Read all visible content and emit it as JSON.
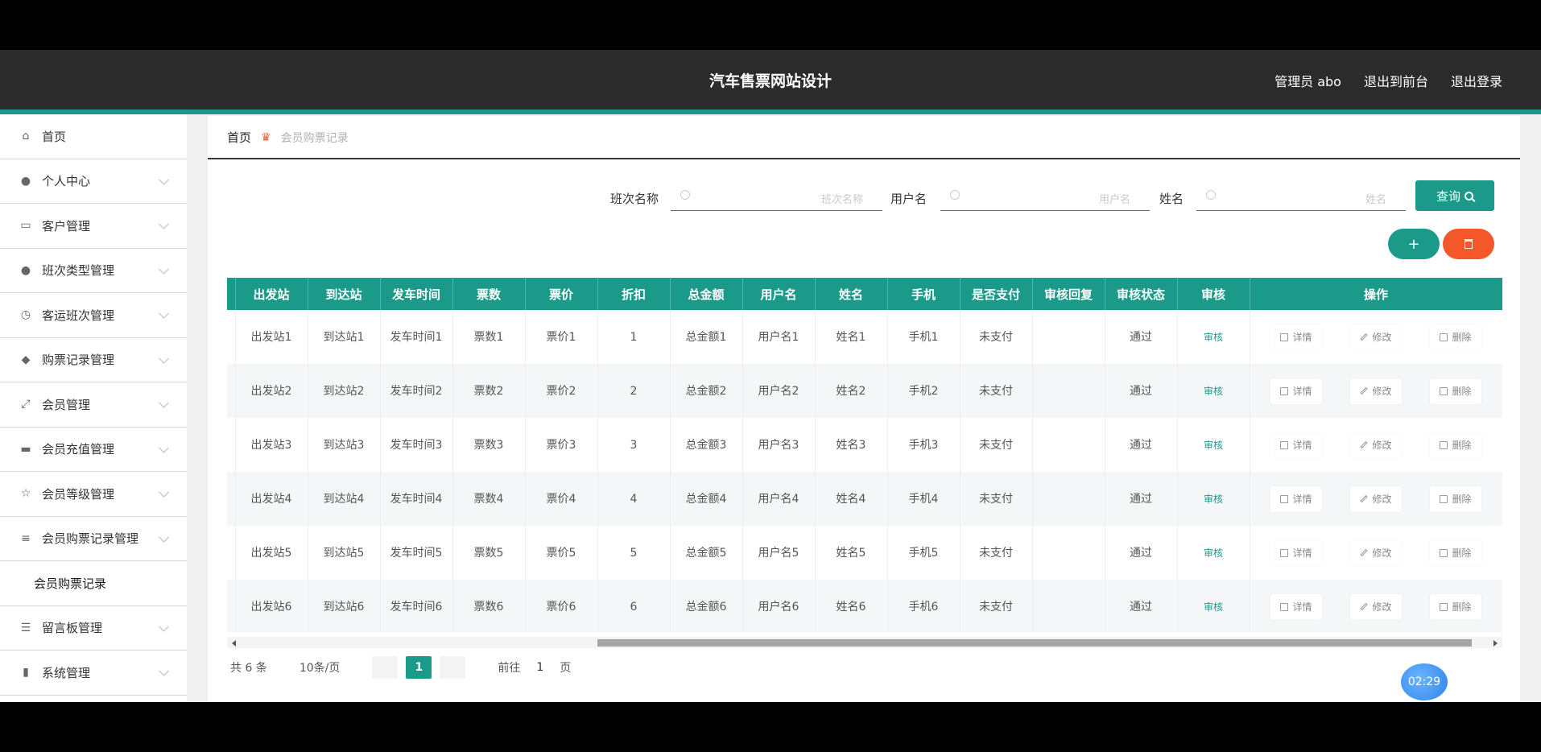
{
  "header": {
    "title": "汽车售票网站设计",
    "links": [
      "管理员 abo",
      "退出到前台",
      "退出登录"
    ]
  },
  "sidebar": {
    "items": [
      {
        "label": "首页",
        "icon": "home-icon",
        "expandable": false
      },
      {
        "label": "个人中心",
        "icon": "user-icon",
        "expandable": true
      },
      {
        "label": "客户管理",
        "icon": "customer-icon",
        "expandable": true
      },
      {
        "label": "班次类型管理",
        "icon": "user-icon",
        "expandable": true
      },
      {
        "label": "客运班次管理",
        "icon": "clock-icon",
        "expandable": true
      },
      {
        "label": "购票记录管理",
        "icon": "ticket-icon",
        "expandable": true
      },
      {
        "label": "会员管理",
        "icon": "expand-icon",
        "expandable": true
      },
      {
        "label": "会员充值管理",
        "icon": "card-icon",
        "expandable": true
      },
      {
        "label": "会员等级管理",
        "icon": "level-icon",
        "expandable": true
      },
      {
        "label": "会员购票记录管理",
        "icon": "list-icon",
        "expandable": true
      },
      {
        "label": "会员购票记录",
        "submenu": true
      },
      {
        "label": "留言板管理",
        "icon": "message-icon",
        "expandable": true
      },
      {
        "label": "系统管理",
        "icon": "chart-icon",
        "expandable": true
      }
    ]
  },
  "breadcrumb": {
    "home": "首页",
    "current": "会员购票记录"
  },
  "search": {
    "fields": [
      {
        "label": "班次名称",
        "placeholder": "班次名称"
      },
      {
        "label": "用户名",
        "placeholder": "用户名"
      },
      {
        "label": "姓名",
        "placeholder": "姓名"
      }
    ],
    "query_label": "查询"
  },
  "actions": {
    "add_label": "+"
  },
  "table": {
    "headers": [
      "出发站",
      "到达站",
      "发车时间",
      "票数",
      "票价",
      "折扣",
      "总金额",
      "用户名",
      "姓名",
      "手机",
      "是否支付",
      "审核回复",
      "审核状态",
      "审核",
      "操作"
    ],
    "rows": [
      {
        "from": "出发站1",
        "to": "到达站1",
        "time": "发车时间1",
        "count": "票数1",
        "price": "票价1",
        "discount": "1",
        "total": "总金额1",
        "username": "用户名1",
        "name": "姓名1",
        "phone": "手机1",
        "paid": "未支付",
        "reply": "",
        "status": "通过"
      },
      {
        "from": "出发站2",
        "to": "到达站2",
        "time": "发车时间2",
        "count": "票数2",
        "price": "票价2",
        "discount": "2",
        "total": "总金额2",
        "username": "用户名2",
        "name": "姓名2",
        "phone": "手机2",
        "paid": "未支付",
        "reply": "",
        "status": "通过"
      },
      {
        "from": "出发站3",
        "to": "到达站3",
        "time": "发车时间3",
        "count": "票数3",
        "price": "票价3",
        "discount": "3",
        "total": "总金额3",
        "username": "用户名3",
        "name": "姓名3",
        "phone": "手机3",
        "paid": "未支付",
        "reply": "",
        "status": "通过"
      },
      {
        "from": "出发站4",
        "to": "到达站4",
        "time": "发车时间4",
        "count": "票数4",
        "price": "票价4",
        "discount": "4",
        "total": "总金额4",
        "username": "用户名4",
        "name": "姓名4",
        "phone": "手机4",
        "paid": "未支付",
        "reply": "",
        "status": "通过"
      },
      {
        "from": "出发站5",
        "to": "到达站5",
        "time": "发车时间5",
        "count": "票数5",
        "price": "票价5",
        "discount": "5",
        "total": "总金额5",
        "username": "用户名5",
        "name": "姓名5",
        "phone": "手机5",
        "paid": "未支付",
        "reply": "",
        "status": "通过"
      },
      {
        "from": "出发站6",
        "to": "到达站6",
        "time": "发车时间6",
        "count": "票数6",
        "price": "票价6",
        "discount": "6",
        "total": "总金额6",
        "username": "用户名6",
        "name": "姓名6",
        "phone": "手机6",
        "paid": "未支付",
        "reply": "",
        "status": "通过"
      }
    ],
    "audit_label": "审核",
    "op_labels": {
      "detail": "详情",
      "edit": "修改",
      "delete": "删除"
    }
  },
  "pager": {
    "total": "共 6 条",
    "size": "10条/页",
    "current": "1",
    "goto_label": "前往",
    "goto_value": "1",
    "page_unit": "页"
  },
  "clock": "02:29",
  "colors": {
    "accent": "#1b9a8a",
    "danger": "#f3572a",
    "header": "#2b2b2b"
  }
}
